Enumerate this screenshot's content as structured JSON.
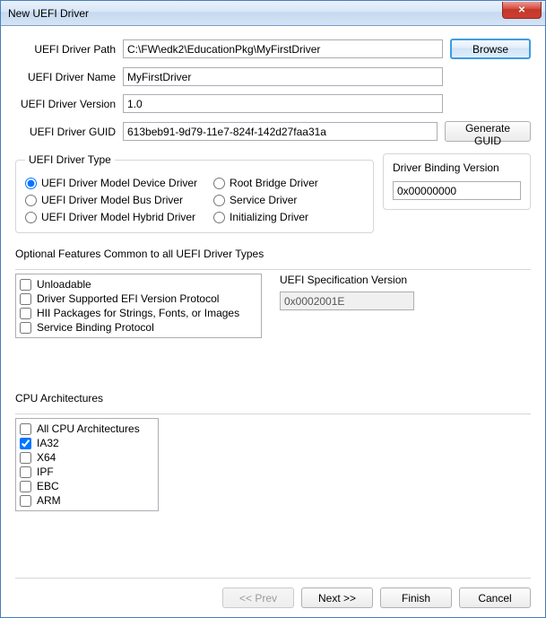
{
  "window": {
    "title": "New UEFI Driver"
  },
  "labels": {
    "path": "UEFI Driver Path",
    "name": "UEFI Driver Name",
    "version": "UEFI Driver Version",
    "guid": "UEFI Driver GUID"
  },
  "values": {
    "path": "C:\\FW\\edk2\\EducationPkg\\MyFirstDriver",
    "name": "MyFirstDriver",
    "version": "1.0",
    "guid": "613beb91-9d79-11e7-824f-142d27faa31a"
  },
  "buttons": {
    "browse": "Browse",
    "generate_guid": "Generate GUID",
    "prev": "<< Prev",
    "next": "Next >>",
    "finish": "Finish",
    "cancel": "Cancel"
  },
  "driver_type": {
    "legend": "UEFI Driver Type",
    "col1": [
      "UEFI Driver Model Device Driver",
      "UEFI Driver Model Bus Driver",
      "UEFI Driver Model Hybrid Driver"
    ],
    "col2": [
      "Root Bridge Driver",
      "Service Driver",
      "Initializing Driver"
    ],
    "selected": 0
  },
  "binding": {
    "label": "Driver Binding Version",
    "value": "0x00000000"
  },
  "features": {
    "section_label": "Optional Features Common to all UEFI Driver Types",
    "items": [
      "Unloadable",
      "Driver Supported EFI Version Protocol",
      "HII Packages for Strings, Fonts, or Images",
      "Service Binding Protocol"
    ]
  },
  "spec": {
    "label": "UEFI Specification Version",
    "value": "0x0002001E"
  },
  "arch": {
    "section_label": "CPU Architectures",
    "items": [
      "All CPU Architectures",
      "IA32",
      "X64",
      "IPF",
      "EBC",
      "ARM"
    ],
    "checked": [
      false,
      true,
      false,
      false,
      false,
      false
    ]
  }
}
